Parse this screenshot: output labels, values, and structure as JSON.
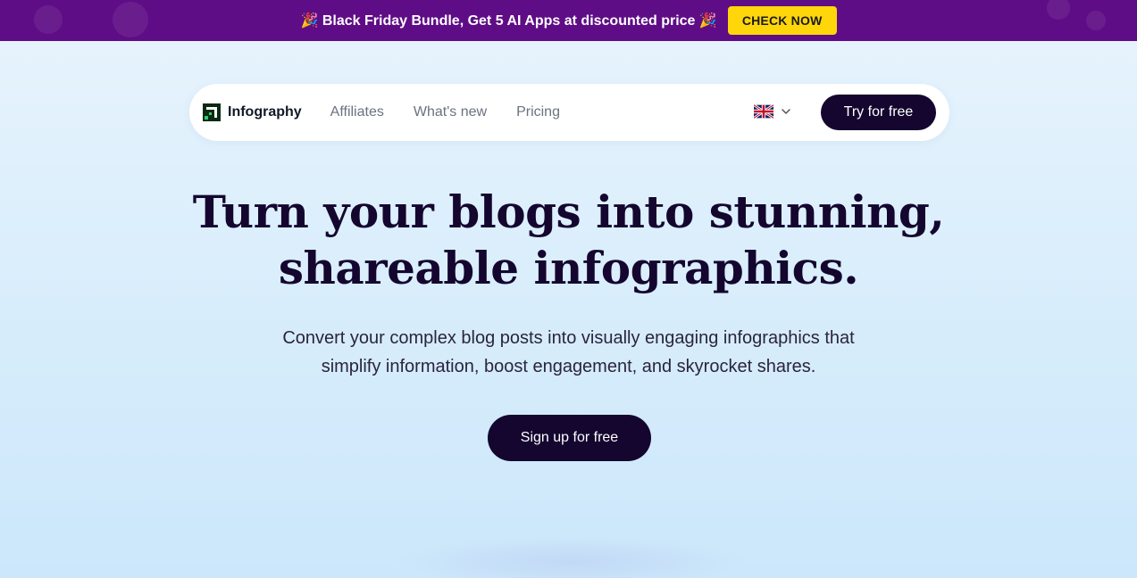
{
  "promo": {
    "text": "🎉 Black Friday Bundle, Get 5 AI Apps at discounted price 🎉",
    "button_label": "CHECK NOW",
    "bg_color": "#5f0d86",
    "button_color": "#ffd60a"
  },
  "nav": {
    "brand": "Infography",
    "links": [
      "Affiliates",
      "What's new",
      "Pricing"
    ],
    "language_icon": "uk-flag-icon",
    "cta_label": "Try for free"
  },
  "hero": {
    "title_line1": "Turn your blogs into stunning,",
    "title_line2": "shareable infographics.",
    "subtitle_line1": "Convert your complex blog posts into visually engaging infographics that",
    "subtitle_line2": "simplify information, boost engagement, and skyrocket shares.",
    "cta_label": "Sign up for free"
  },
  "colors": {
    "primary_dark": "#14062f",
    "background": "#e8f4fd"
  }
}
